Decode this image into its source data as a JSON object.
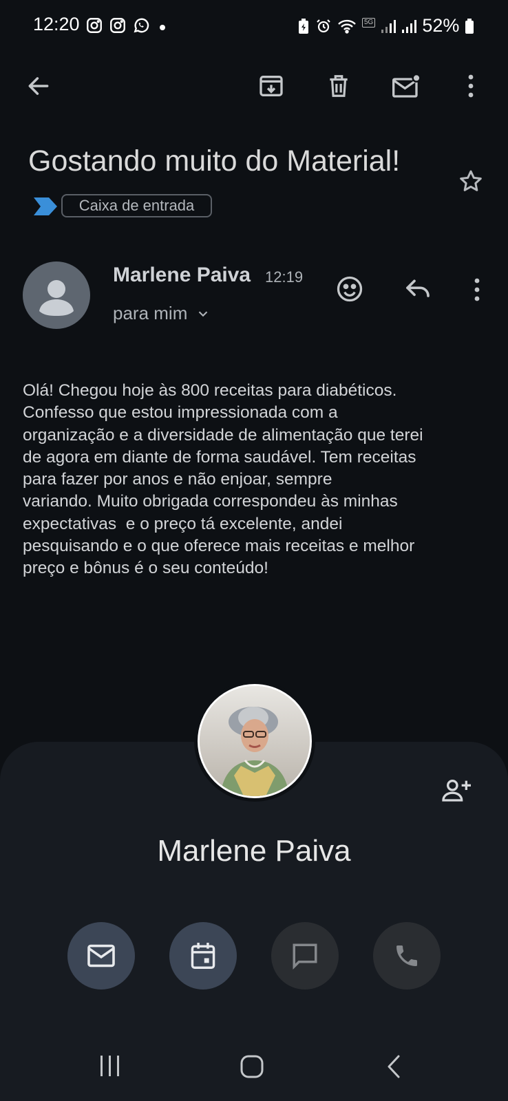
{
  "status_bar": {
    "time": "12:20",
    "network_badge": "5G",
    "battery": "52%"
  },
  "toolbar": {
    "icons": [
      "back-arrow-icon",
      "archive-icon",
      "delete-icon",
      "mark-unread-icon",
      "more-vert-icon"
    ]
  },
  "email": {
    "subject": "Gostando muito do Material!",
    "label": "Caixa de entrada",
    "sender_name": "Marlene Paiva",
    "sent_time": "12:19",
    "recipient": "para mim",
    "body": "Olá! Chegou hoje às 800 receitas para diabéticos.\nConfesso que estou impressionada com a\norganização e a diversidade de alimentação que terei\nde agora em diante de forma saudável. Tem receitas\npara fazer por anos e não enjoar, sempre\nvariando. Muito obrigada correspondeu às minhas\nexpectativas  e o preço tá excelente, andei\npesquisando e o que oferece mais receitas e melhor\npreço e bônus é o seu conteúdo!"
  },
  "contact_card": {
    "name": "Marlene Paiva",
    "actions": [
      "mail-icon",
      "calendar-icon",
      "chat-icon",
      "phone-icon"
    ]
  },
  "colors": {
    "background": "#0d1014",
    "sheet": "#171b21",
    "active_button": "#3c4656",
    "inactive_button": "#2a2d31",
    "important_marker": "#3a8fd9"
  }
}
